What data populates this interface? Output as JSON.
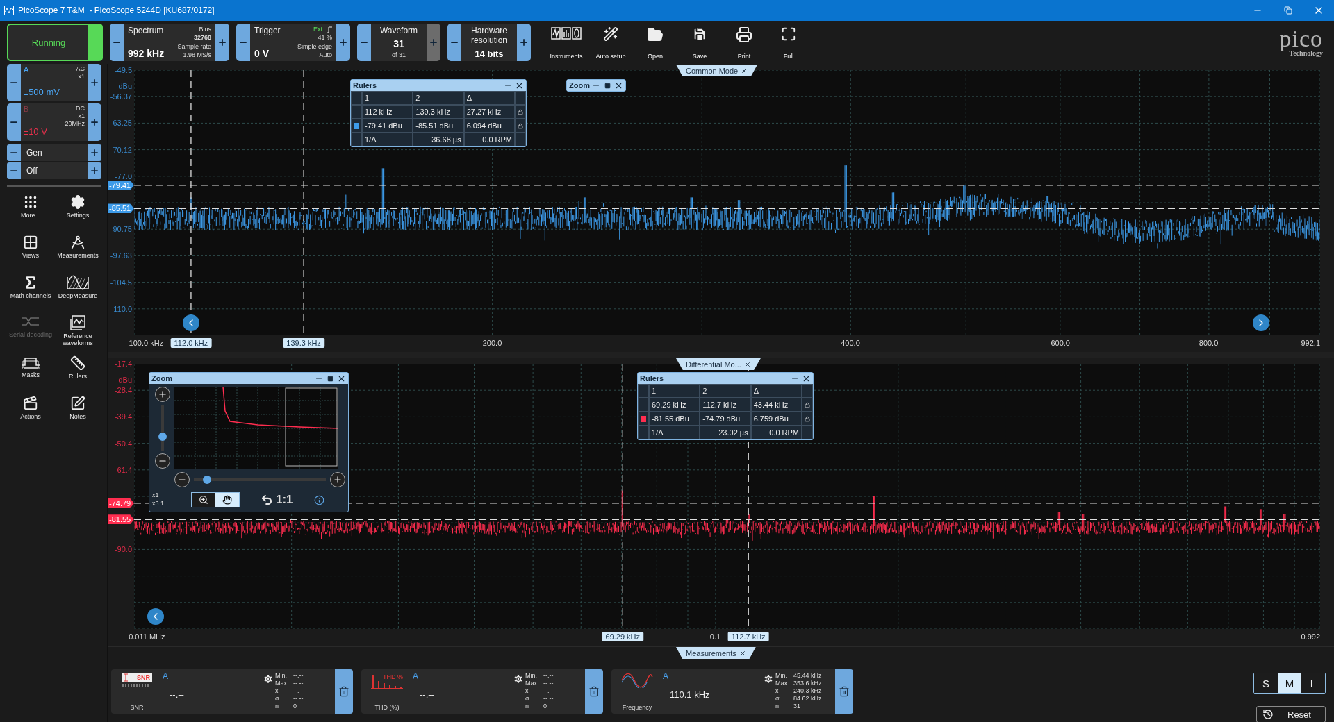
{
  "window": {
    "title": "PicoScope 7 T&M  - PicoScope 5244D [KU687/0172]"
  },
  "run_button": {
    "label": "Running",
    "on": true
  },
  "spectrum": {
    "label": "Spectrum",
    "value": "992 kHz",
    "details": [
      "Bins",
      "32768",
      "Sample rate",
      "1.98 MS/s"
    ]
  },
  "trigger": {
    "label": "Trigger",
    "value": "0 V",
    "source": "Ext",
    "details": [
      "41 %",
      "Simple edge",
      "Auto"
    ]
  },
  "waveform": {
    "label": "Waveform",
    "value": "31",
    "sub": "of 31",
    "plus_disabled": true
  },
  "resolution": {
    "label": "Hardware resolution",
    "value": "14 bits"
  },
  "actions": [
    {
      "label": "Instruments",
      "kind": "instruments"
    },
    {
      "label": "Auto setup",
      "kind": "autosetup"
    },
    {
      "label": "Open",
      "kind": "open"
    },
    {
      "label": "Save",
      "kind": "save"
    },
    {
      "label": "Print",
      "kind": "print"
    },
    {
      "label": "Full",
      "kind": "full"
    }
  ],
  "logo": {
    "name": "pico",
    "sub": "Technology"
  },
  "channels": [
    {
      "name": "A",
      "coupling": [
        "AC",
        "x1"
      ],
      "range": "±500 mV",
      "color": "#4aa3f0",
      "enabled": true
    },
    {
      "name": "B",
      "coupling": [
        "DC",
        "x1",
        "20MHz"
      ],
      "range": "±10 V",
      "color": "#e8304c",
      "enabled": false
    }
  ],
  "generator": [
    "Gen",
    "Off"
  ],
  "tools": [
    {
      "label": "More...",
      "kind": "more",
      "disabled": false
    },
    {
      "label": "Settings",
      "kind": "settings",
      "disabled": false
    },
    {
      "label": "Views",
      "kind": "views",
      "disabled": false
    },
    {
      "label": "Measurements",
      "kind": "measurements",
      "disabled": false
    },
    {
      "label": "Math channels",
      "kind": "math",
      "disabled": false
    },
    {
      "label": "DeepMeasure",
      "kind": "deepmeasure",
      "disabled": false
    },
    {
      "label": "Serial decoding",
      "kind": "serial",
      "disabled": true
    },
    {
      "label": "Reference waveforms",
      "kind": "reference",
      "disabled": false
    },
    {
      "label": "Masks",
      "kind": "masks",
      "disabled": false
    },
    {
      "label": "Rulers",
      "kind": "rulers",
      "disabled": false
    },
    {
      "label": "Actions",
      "kind": "actions",
      "disabled": false
    },
    {
      "label": "Notes",
      "kind": "notes",
      "disabled": false
    }
  ],
  "views": [
    {
      "tab": "Common Mode",
      "color": "#3d9be9",
      "unit": "dBu",
      "y_labels": [
        "-49.5",
        "-56.37",
        "-63.25",
        "-70.12",
        "-77.0",
        "-90.75",
        "-97.63",
        "-104.5",
        "-110.0"
      ],
      "x_labels": [
        "100.0 kHz",
        "200.0",
        "400.0",
        "600.0",
        "800.0",
        "992.1"
      ],
      "ruler_tags": [
        "112.0 kHz",
        "139.3 kHz"
      ],
      "level_tags": [
        "-79.41",
        "-85.51"
      ],
      "nav_arrows": [
        {
          "kind": "left"
        },
        {
          "kind": "right"
        }
      ],
      "rulers": {
        "title": "Rulers",
        "columns": [
          "1",
          "2",
          "Δ"
        ],
        "rows": [
          [
            "112 kHz",
            "139.3 kHz",
            "27.27 kHz"
          ],
          [
            "-79.41 dBu",
            "-85.51 dBu",
            "6.094 dBu"
          ]
        ],
        "footer": [
          "1/Δ",
          "36.68 µs",
          "0.0 RPM"
        ]
      },
      "zoom": {
        "title": "Zoom",
        "expanded": false
      }
    },
    {
      "tab": "Differential Mo...",
      "color": "#ff2d4f",
      "unit": "dBu",
      "y_labels": [
        "-17.4",
        "-28.4",
        "-39.4",
        "-50.4",
        "-61.4",
        "-90.0"
      ],
      "x_labels": [
        "0.011 MHz",
        "0.1",
        "0.992"
      ],
      "ruler_tags": [
        "69.29 kHz",
        "112.7 kHz"
      ],
      "level_tags": [
        "-74.79",
        "-81.55"
      ],
      "nav_arrows": [
        {
          "kind": "left"
        }
      ],
      "rulers": {
        "title": "Rulers",
        "columns": [
          "1",
          "2",
          "Δ"
        ],
        "rows": [
          [
            "69.29 kHz",
            "112.7 kHz",
            "43.44 kHz"
          ],
          [
            "-81.55 dBu",
            "-74.79 dBu",
            "6.759 dBu"
          ]
        ],
        "footer": [
          "1/Δ",
          "23.02 µs",
          "0.0 RPM"
        ]
      },
      "zoom": {
        "title": "Zoom",
        "expanded": true,
        "scales": [
          "x1",
          "x3.1"
        ],
        "reset": "1:1",
        "sliders": [
          {
            "kind": "vertical",
            "level": 0.3
          },
          {
            "kind": "horizontal",
            "level": 0.1
          }
        ],
        "modes": [
          {
            "kind": "zoom",
            "selected": false
          },
          {
            "kind": "pan",
            "selected": true
          }
        ]
      }
    }
  ],
  "measurements": {
    "tab": "Measurements",
    "cards": [
      {
        "kind": "snr",
        "badge": "SNR",
        "channel": "A",
        "name": "SNR",
        "value": "--.--",
        "stats": [
          {
            "label": "Min.",
            "value": "--.--"
          },
          {
            "label": "Max.",
            "value": "--.--"
          },
          {
            "label": "x̄",
            "value": "--.--"
          },
          {
            "label": "σ",
            "value": "--.--"
          },
          {
            "label": "n",
            "value": "0"
          }
        ]
      },
      {
        "kind": "thd",
        "badge": "THD %",
        "channel": "A",
        "name": "THD (%)",
        "value": "--.--",
        "stats": [
          {
            "label": "Min.",
            "value": "--.--"
          },
          {
            "label": "Max.",
            "value": "--.--"
          },
          {
            "label": "x̄",
            "value": "--.--"
          },
          {
            "label": "σ",
            "value": "--.--"
          },
          {
            "label": "n",
            "value": "0"
          }
        ]
      },
      {
        "kind": "frequency",
        "channel": "A",
        "name": "Frequency",
        "value": "110.1 kHz",
        "stats": [
          {
            "label": "Min.",
            "value": "45.44 kHz"
          },
          {
            "label": "Max.",
            "value": "353.6 kHz"
          },
          {
            "label": "x̄",
            "value": "240.3 kHz"
          },
          {
            "label": "σ",
            "value": "84.62 kHz"
          },
          {
            "label": "n",
            "value": "31"
          }
        ]
      }
    ]
  },
  "size_options": [
    {
      "label": "S",
      "selected": false
    },
    {
      "label": "M",
      "selected": true
    },
    {
      "label": "L",
      "selected": false
    }
  ],
  "reset": "Reset"
}
